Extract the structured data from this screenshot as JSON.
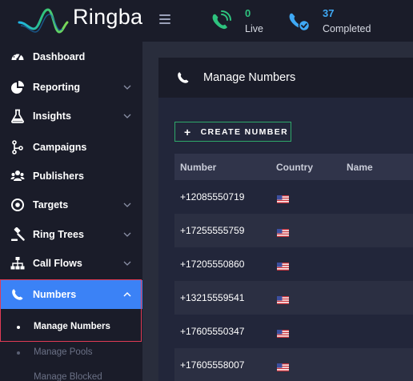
{
  "app": {
    "brand": "Ringba"
  },
  "header": {
    "stats": [
      {
        "value": "0",
        "label": "Live",
        "icon": "phone-ringing-icon",
        "color": "#2ec27e"
      },
      {
        "value": "37",
        "label": "Completed",
        "icon": "phone-check-icon",
        "color": "#3fa9f5"
      }
    ]
  },
  "sidebar": {
    "items": [
      {
        "label": "Dashboard",
        "icon": "dashboard-gauge-icon",
        "has_chevron": false
      },
      {
        "label": "Reporting",
        "icon": "pie-chart-icon",
        "has_chevron": true
      },
      {
        "label": "Insights",
        "icon": "flask-icon",
        "has_chevron": true
      },
      {
        "label": "Campaigns",
        "icon": "campaign-branch-icon",
        "has_chevron": false
      },
      {
        "label": "Publishers",
        "icon": "publishers-users-icon",
        "has_chevron": false
      },
      {
        "label": "Targets",
        "icon": "target-icon",
        "has_chevron": true
      },
      {
        "label": "Ring Trees",
        "icon": "gavel-icon",
        "has_chevron": true
      },
      {
        "label": "Call Flows",
        "icon": "sitemap-icon",
        "has_chevron": true
      },
      {
        "label": "Numbers",
        "icon": "phone-handset-icon",
        "has_chevron": true,
        "active": true,
        "expanded": true
      }
    ],
    "subitems": [
      {
        "label": "Manage Numbers",
        "active": true
      },
      {
        "label": "Manage Pools",
        "active": false
      },
      {
        "label": "Manage Blocked",
        "active": false
      }
    ],
    "accent_color": "#3b82f6"
  },
  "page": {
    "title": "Manage Numbers",
    "create_button_label": "CREATE NUMBER"
  },
  "table": {
    "columns": [
      "Number",
      "Country",
      "Name"
    ],
    "rows": [
      {
        "number": "+12085550719",
        "country_flag": "us-flag-icon"
      },
      {
        "number": "+17255555759",
        "country_flag": "us-flag-icon"
      },
      {
        "number": "+17205550860",
        "country_flag": "us-flag-icon"
      },
      {
        "number": "+13215559541",
        "country_flag": "us-flag-icon"
      },
      {
        "number": "+17605550347",
        "country_flag": "us-flag-icon"
      },
      {
        "number": "+17605558007",
        "country_flag": "us-flag-icon"
      }
    ]
  }
}
